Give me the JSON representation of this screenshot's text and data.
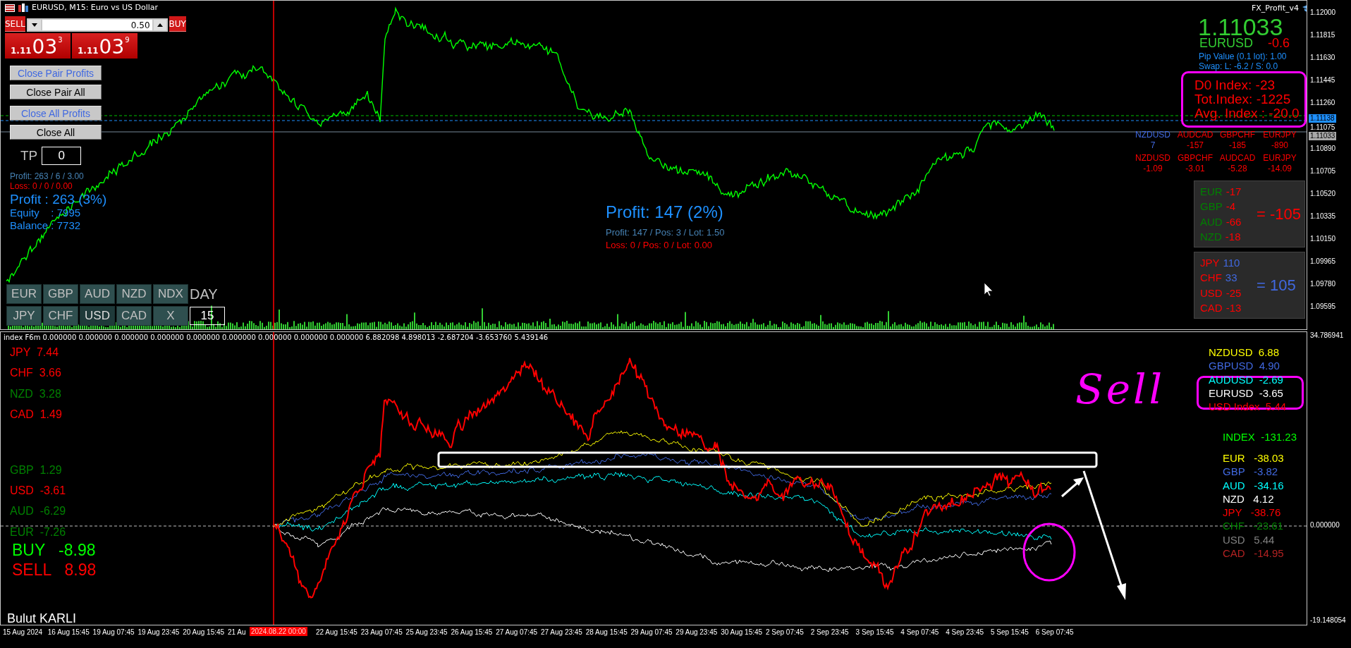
{
  "window": {
    "title": "EURUSD, M15:  Euro vs US Dollar"
  },
  "trade_panel": {
    "sell": {
      "label": "SELL",
      "big": "1.11",
      "pips": "03",
      "point": "3"
    },
    "lot": "0.50",
    "buy": {
      "label": "BUY",
      "big": "1.11",
      "pips": "03",
      "point": "9"
    }
  },
  "buttons": [
    {
      "label": "Close Pair Profits",
      "kind": "profit"
    },
    {
      "label": "Close Pair All",
      "kind": "all"
    },
    {
      "label": "Close All Profits",
      "kind": "profit"
    },
    {
      "label": "Close All",
      "kind": "all"
    }
  ],
  "tp": {
    "label": "TP",
    "value": "0"
  },
  "account": {
    "profit_line": "Profit: 263 / 6 / 3.00",
    "loss_line": "Loss: 0 / 0 / 0.00",
    "profit": "Profit : 263 (3%)",
    "equity": "Equity    : 7995",
    "balance": "Balance : 7732"
  },
  "currency_buttons": [
    [
      {
        "label": "EUR",
        "selected": false
      },
      {
        "label": "GBP",
        "selected": false
      },
      {
        "label": "AUD",
        "selected": false
      },
      {
        "label": "NZD",
        "selected": false
      },
      {
        "label": "NDX",
        "selected": false
      }
    ],
    [
      {
        "label": "JPY",
        "selected": false
      },
      {
        "label": "CHF",
        "selected": false
      },
      {
        "label": "USD",
        "selected": true
      },
      {
        "label": "CAD",
        "selected": false
      },
      {
        "label": "X",
        "selected": false
      }
    ]
  ],
  "day": {
    "label": "DAY",
    "value": "15"
  },
  "center_profit": {
    "title": "Profit: 147 (2%)",
    "profit_line": "Profit: 147 / Pos: 3 / Lot: 1.50",
    "loss_line": "Loss: 0 / Pos: 0 / Lot: 0.00"
  },
  "indicator_name": "FX_Profit_v4",
  "quote": {
    "price": "1.11033",
    "symbol": "EURUSD",
    "change": "-0.6",
    "pip_value": "Pip Value (0.1 lot): 1.00",
    "swap": "Swap: L: -6.2 / S: 0.0"
  },
  "index_box": [
    "D0 Index: -23",
    "Tot.Index: -1225",
    "Avg. Index : -20.0"
  ],
  "pairs_top": [
    {
      "pair": "NZDUSD",
      "value": "7",
      "color": "#4169e1"
    },
    {
      "pair": "AUDCAD",
      "value": "-157",
      "color": "#ff0000"
    },
    {
      "pair": "GBPCHF",
      "value": "-185",
      "color": "#ff0000"
    },
    {
      "pair": "EURJPY",
      "value": "-890",
      "color": "#ff0000"
    }
  ],
  "pairs_bottom": [
    {
      "pair": "NZDUSD",
      "value": "-1.09",
      "color": "#ff0000"
    },
    {
      "pair": "GBPCHF",
      "value": "-3.01",
      "color": "#ff0000"
    },
    {
      "pair": "AUDCAD",
      "value": "-5.28",
      "color": "#ff0000"
    },
    {
      "pair": "EURJPY",
      "value": "-14.09",
      "color": "#ff0000"
    }
  ],
  "group_a": {
    "items": [
      {
        "code": {
          "text": "EUR",
          "color": "#008000"
        },
        "value": {
          "text": "-17",
          "color": "#ff0000"
        }
      },
      {
        "code": {
          "text": "GBP",
          "color": "#008000"
        },
        "value": {
          "text": "-4",
          "color": "#ff0000"
        }
      },
      {
        "code": {
          "text": "AUD",
          "color": "#008000"
        },
        "value": {
          "text": "-66",
          "color": "#ff0000"
        }
      },
      {
        "code": {
          "text": "NZD",
          "color": "#008000"
        },
        "value": {
          "text": "-18",
          "color": "#ff0000"
        }
      }
    ],
    "total": {
      "text": "= -105",
      "color": "#ff0000"
    }
  },
  "group_b": {
    "items": [
      {
        "code": {
          "text": "JPY",
          "color": "#ff0000"
        },
        "value": {
          "text": "110",
          "color": "#4169e1"
        }
      },
      {
        "code": {
          "text": "CHF",
          "color": "#ff0000"
        },
        "value": {
          "text": "33",
          "color": "#4169e1"
        }
      },
      {
        "code": {
          "text": "USD",
          "color": "#ff0000"
        },
        "value": {
          "text": "-25",
          "color": "#ff0000"
        }
      },
      {
        "code": {
          "text": "CAD",
          "color": "#ff0000"
        },
        "value": {
          "text": "-13",
          "color": "#ff0000"
        }
      }
    ],
    "total": {
      "text": "= 105",
      "color": "#4169e1"
    }
  },
  "price_axis": [
    {
      "label": "1.12000",
      "kind": "tick"
    },
    {
      "label": "1.11815",
      "kind": "tick"
    },
    {
      "label": "1.11630",
      "kind": "tick"
    },
    {
      "label": "1.11445",
      "kind": "tick"
    },
    {
      "label": "1.11260",
      "kind": "tick"
    },
    {
      "label": "1.11138",
      "kind": "ask"
    },
    {
      "label": "1.11075",
      "kind": "tick"
    },
    {
      "label": "1.11033",
      "kind": "bid"
    },
    {
      "label": "1.10890",
      "kind": "tick"
    },
    {
      "label": "1.10705",
      "kind": "tick"
    },
    {
      "label": "1.10520",
      "kind": "tick"
    },
    {
      "label": "1.10335",
      "kind": "tick"
    },
    {
      "label": "1.10150",
      "kind": "tick"
    },
    {
      "label": "1.09965",
      "kind": "tick"
    },
    {
      "label": "1.09780",
      "kind": "tick"
    },
    {
      "label": "1.09595",
      "kind": "tick"
    }
  ],
  "index_header": "index F6m 0.000000 0.000000 0.000000 0.000000 0.000000 0.000000 0.000000 0.000000 0.000000 6.882098 4.898013 -2.687204 -3.653760 5.439146",
  "left_strengths": [
    [
      {
        "label": "JPY",
        "value": "7.44",
        "color": "#ff0000"
      },
      {
        "label": "CHF",
        "value": "3.66",
        "color": "#ff0000"
      },
      {
        "label": "NZD",
        "value": "3.28",
        "color": "#008000"
      },
      {
        "label": "CAD",
        "value": "1.49",
        "color": "#ff0000"
      }
    ],
    [
      {
        "label": "GBP",
        "value": "1.29",
        "color": "#008000"
      },
      {
        "label": "USD",
        "value": "-3.61",
        "color": "#ff0000"
      },
      {
        "label": "AUD",
        "value": "-6.29",
        "color": "#008000"
      },
      {
        "label": "EUR",
        "value": "-7.26",
        "color": "#008000"
      }
    ]
  ],
  "signals": [
    {
      "label": "BUY",
      "value": "-8.98",
      "color": "#00ff00"
    },
    {
      "label": "SELL",
      "value": "8.98",
      "color": "#ff0000"
    }
  ],
  "author": "Bulut KARLI",
  "annotation_text": "Sell",
  "pair_values": [
    {
      "pair": "NZDUSD",
      "value": "6.88",
      "color": "#ffff00"
    },
    {
      "pair": "GBPUSD",
      "value": "4.90",
      "color": "#4169e1"
    },
    {
      "pair": "AUDUSD",
      "value": "-2.69",
      "color": "#00ffff"
    },
    {
      "pair": "EURUSD",
      "value": "-3.65",
      "color": "#ffffff"
    },
    {
      "pair": "USD Index",
      "value": "5.44",
      "color": "#ff0000"
    }
  ],
  "index_total": {
    "label": "INDEX",
    "value": "-131.23"
  },
  "currency_values": [
    {
      "label": "EUR",
      "value": "-38.03",
      "color": "#ffff00"
    },
    {
      "label": "GBP",
      "value": "-3.82",
      "color": "#4169e1"
    },
    {
      "label": "AUD",
      "value": "-34.16",
      "color": "#00ffff"
    },
    {
      "label": "NZD",
      "value": "4.12",
      "color": "#ffffff"
    },
    {
      "label": "JPY",
      "value": "-38.76",
      "color": "#ff0000"
    },
    {
      "label": "CHF",
      "value": "-23.61",
      "color": "#008000"
    },
    {
      "label": "USD",
      "value": "5.44",
      "color": "#808080"
    },
    {
      "label": "CAD",
      "value": "-14.95",
      "color": "#b22222"
    }
  ],
  "index_axis": [
    {
      "label": "34.786941",
      "kind": "top"
    },
    {
      "label": "0.000000",
      "kind": "zero"
    },
    {
      "label": "-19.148054",
      "kind": "bottom"
    }
  ],
  "time_axis": [
    "15 Aug 2024",
    "16 Aug 15:45",
    "19 Aug 07:45",
    "19 Aug 23:45",
    "20 Aug 15:45",
    "21 Au",
    "22 Aug 15:45",
    "23 Aug 07:45",
    "25 Aug 23:45",
    "26 Aug 15:45",
    "27 Aug 07:45",
    "27 Aug 23:45",
    "28 Aug 15:45",
    "29 Aug 07:45",
    "29 Aug 23:45",
    "30 Aug 15:45",
    "2 Sep 07:45",
    "2 Sep 23:45",
    "3 Sep 15:45",
    "4 Sep 07:45",
    "4 Sep 23:45",
    "5 Sep 15:45",
    "6 Sep 07:45"
  ],
  "cursor_time": "2024.08.22 00:00"
}
